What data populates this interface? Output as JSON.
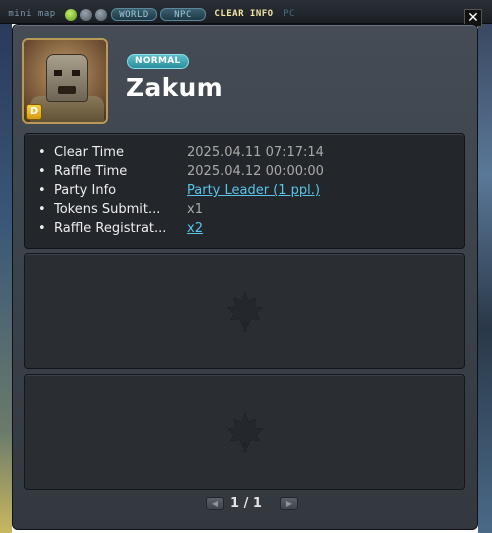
{
  "minimap": {
    "title": "mini map",
    "tabs": [
      "WORLD",
      "NPC"
    ],
    "active_tab": "CLEAR INFO",
    "trailing_tab": "PC",
    "close_label": "✕"
  },
  "boss": {
    "difficulty": "NORMAL",
    "name": "Zakum",
    "grade": "D"
  },
  "info": [
    {
      "label": "Clear Time",
      "value": "2025.04.11 07:17:14",
      "link": false
    },
    {
      "label": "Raffle Time",
      "value": "2025.04.12 00:00:00",
      "link": false
    },
    {
      "label": "Party Info",
      "value": "Party Leader (1 ppl.)",
      "link": true
    },
    {
      "label": "Tokens Submit...",
      "value": "x1",
      "link": false
    },
    {
      "label": "Raffle Registrat...",
      "value": "x2",
      "link": true
    }
  ],
  "pagination": {
    "text": "1 / 1",
    "prev_icon": "chevron-left-icon",
    "next_icon": "chevron-right-icon"
  },
  "colors": {
    "accent": "#59c6e8",
    "badge": "#3fa9b6",
    "panel": "#3c4249"
  }
}
